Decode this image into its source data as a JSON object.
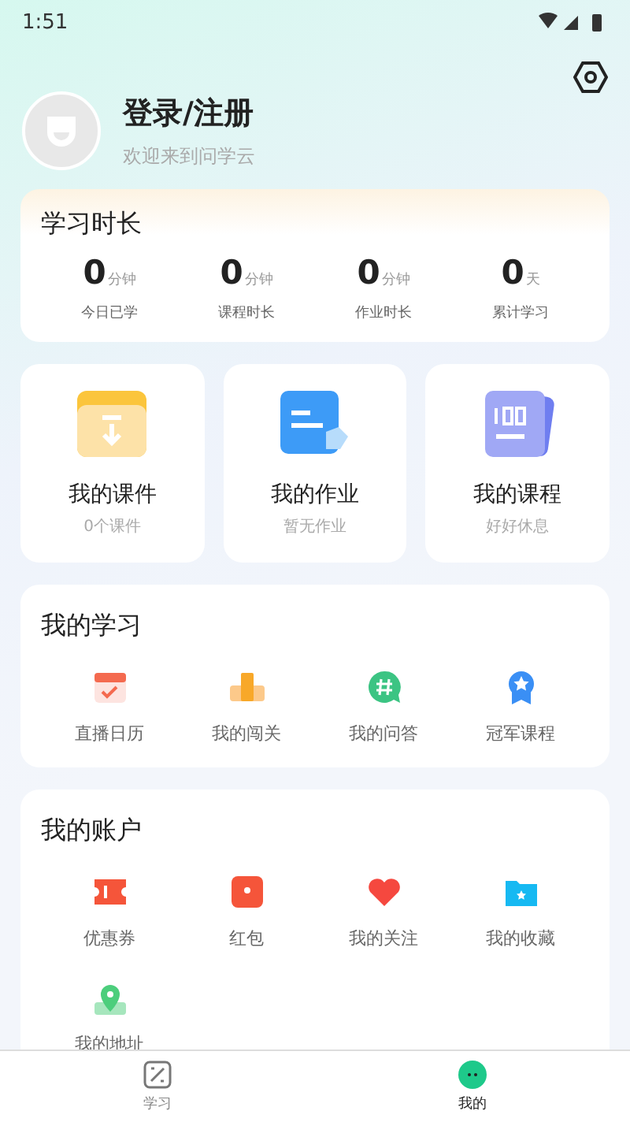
{
  "status_bar": {
    "time": "1:51"
  },
  "profile": {
    "name": "登录/注册",
    "subtitle": "欢迎来到问学云"
  },
  "study_time": {
    "title": "学习时长",
    "stats": [
      {
        "value": "0",
        "unit": "分钟",
        "label": "今日已学"
      },
      {
        "value": "0",
        "unit": "分钟",
        "label": "课程时长"
      },
      {
        "value": "0",
        "unit": "分钟",
        "label": "作业时长"
      },
      {
        "value": "0",
        "unit": "天",
        "label": "累计学习"
      }
    ]
  },
  "cards": [
    {
      "kind": "courseware",
      "title": "我的课件",
      "subtitle": "0个课件"
    },
    {
      "kind": "homework",
      "title": "我的作业",
      "subtitle": "暂无作业"
    },
    {
      "kind": "course",
      "title": "我的课程",
      "subtitle": "好好休息"
    }
  ],
  "my_study": {
    "title": "我的学习",
    "items": [
      {
        "kind": "calendar",
        "label": "直播日历"
      },
      {
        "kind": "podium",
        "label": "我的闯关"
      },
      {
        "kind": "hashtag",
        "label": "我的问答"
      },
      {
        "kind": "medal",
        "label": "冠军课程"
      }
    ]
  },
  "my_account": {
    "title": "我的账户",
    "items": [
      {
        "kind": "ticket",
        "label": "优惠券"
      },
      {
        "kind": "redpacket",
        "label": "红包"
      },
      {
        "kind": "heart",
        "label": "我的关注"
      },
      {
        "kind": "folder",
        "label": "我的收藏"
      },
      {
        "kind": "pin",
        "label": "我的地址"
      }
    ]
  },
  "tab_bar": [
    {
      "kind": "study",
      "label": "学习",
      "selected": false
    },
    {
      "kind": "me",
      "label": "我的",
      "selected": true
    }
  ]
}
